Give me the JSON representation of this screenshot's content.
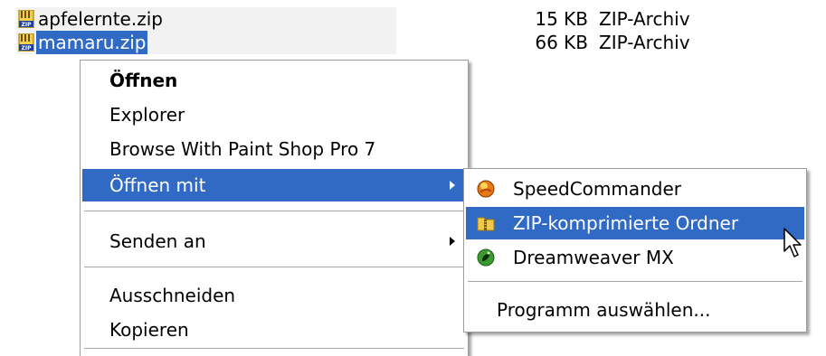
{
  "files": [
    {
      "name": "apfelernte.zip",
      "size": "15 KB",
      "type": "ZIP-Archiv",
      "icon": "zip-file-icon"
    },
    {
      "name": "mamaru.zip",
      "size": "66 KB",
      "type": "ZIP-Archiv",
      "icon": "zip-file-icon"
    }
  ],
  "context_menu": {
    "items": [
      {
        "label": "Öffnen"
      },
      {
        "label": "Explorer"
      },
      {
        "label": "Browse With Paint Shop Pro 7"
      },
      {
        "label": "Öffnen mit"
      },
      {
        "label": "Senden an"
      },
      {
        "label": "Ausschneiden"
      },
      {
        "label": "Kopieren"
      }
    ]
  },
  "submenu": {
    "items": [
      {
        "label": "SpeedCommander",
        "icon": "speedcommander-icon"
      },
      {
        "label": "ZIP-komprimierte Ordner",
        "icon": "zip-folder-icon"
      },
      {
        "label": "Dreamweaver MX",
        "icon": "dreamweaver-icon"
      },
      {
        "label": "Programm auswählen..."
      }
    ]
  },
  "colors": {
    "selection": "#316ac5",
    "menu_border": "#9d9d9d"
  }
}
